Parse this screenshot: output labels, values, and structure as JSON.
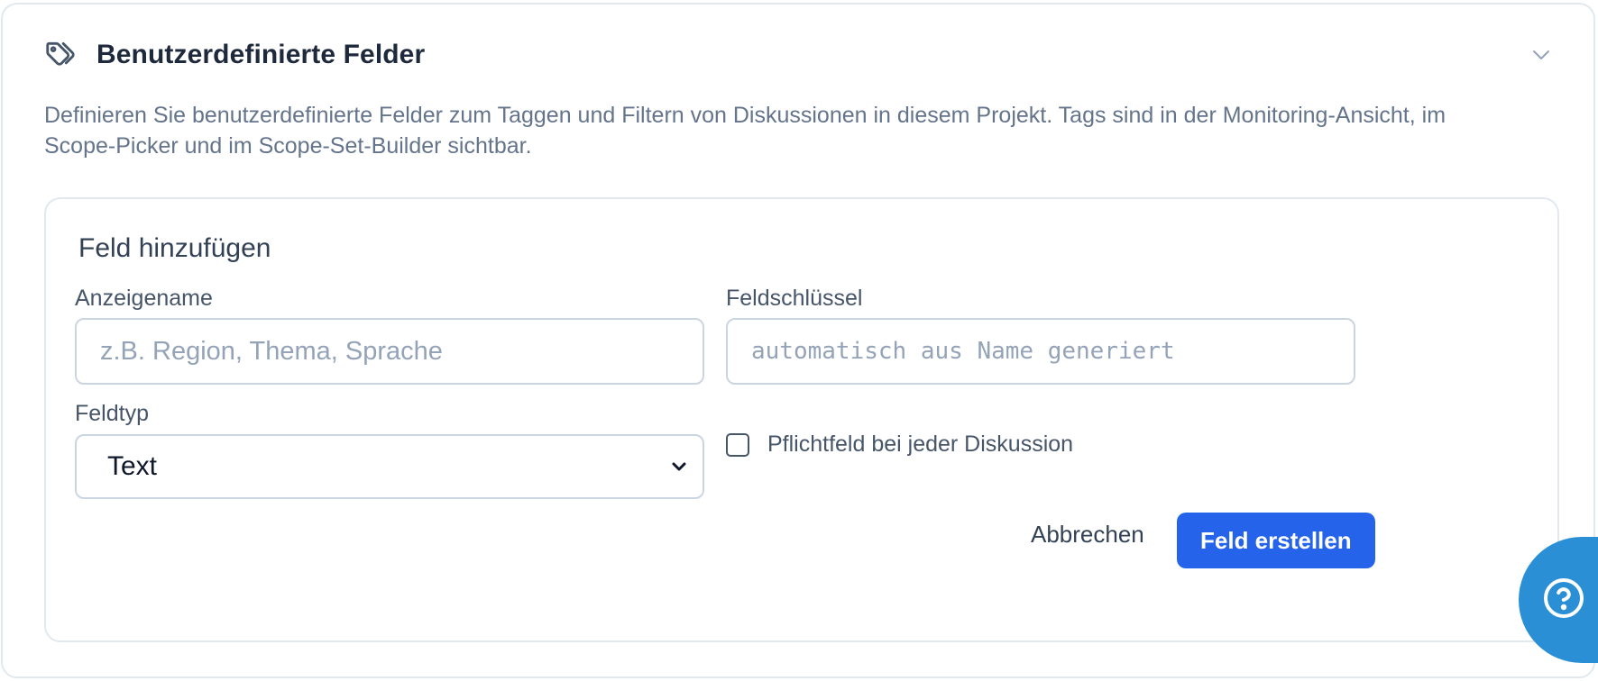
{
  "section": {
    "title": "Benutzerdefinierte Felder",
    "description": "Definieren Sie benutzerdefinierte Felder zum Taggen und Filtern von Diskussionen in diesem Projekt. Tags sind in der Monitoring-Ansicht, im Scope-Picker und im Scope-Set-Builder sichtbar.",
    "icon": "tags-icon",
    "collapse_icon": "chevron-down-icon"
  },
  "form": {
    "title": "Feld hinzufügen",
    "display_name": {
      "label": "Anzeigename",
      "value": "",
      "placeholder": "z.B. Region, Thema, Sprache"
    },
    "field_key": {
      "label": "Feldschlüssel",
      "value": "",
      "placeholder": "automatisch aus Name generiert"
    },
    "field_type": {
      "label": "Feldtyp",
      "selected": "Text"
    },
    "required": {
      "label": "Pflichtfeld bei jeder Diskussion",
      "checked": false
    },
    "cancel_label": "Abbrechen",
    "submit_label": "Feld erstellen"
  },
  "help": {
    "icon": "help-circle-icon"
  },
  "colors": {
    "primary": "#2563eb",
    "help": "#2b8fd6",
    "muted_text": "#64748b",
    "border": "#e2e8f0"
  }
}
